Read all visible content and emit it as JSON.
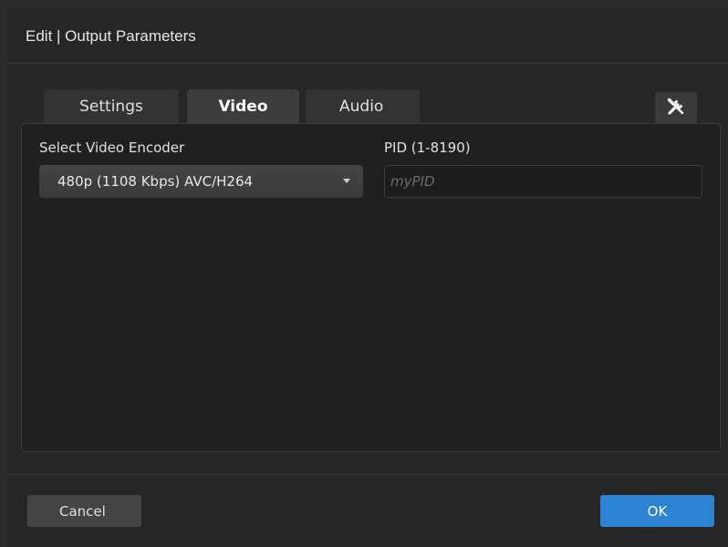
{
  "dialog": {
    "title": "Edit | Output Parameters"
  },
  "tabs": [
    {
      "label": "Settings",
      "active": false
    },
    {
      "label": "Video",
      "active": true
    },
    {
      "label": "Audio",
      "active": false
    }
  ],
  "toolbar": {
    "tools_icon": "wrench-screwdriver-icon"
  },
  "video": {
    "encoder_label": "Select Video Encoder",
    "encoder_value": "480p (1108 Kbps) AVC/H264",
    "pid_label": "PID (1-8190)",
    "pid_value": "",
    "pid_placeholder": "myPID"
  },
  "footer": {
    "cancel_label": "Cancel",
    "ok_label": "OK"
  },
  "colors": {
    "accent": "#2c83d3",
    "background": "#262626"
  }
}
